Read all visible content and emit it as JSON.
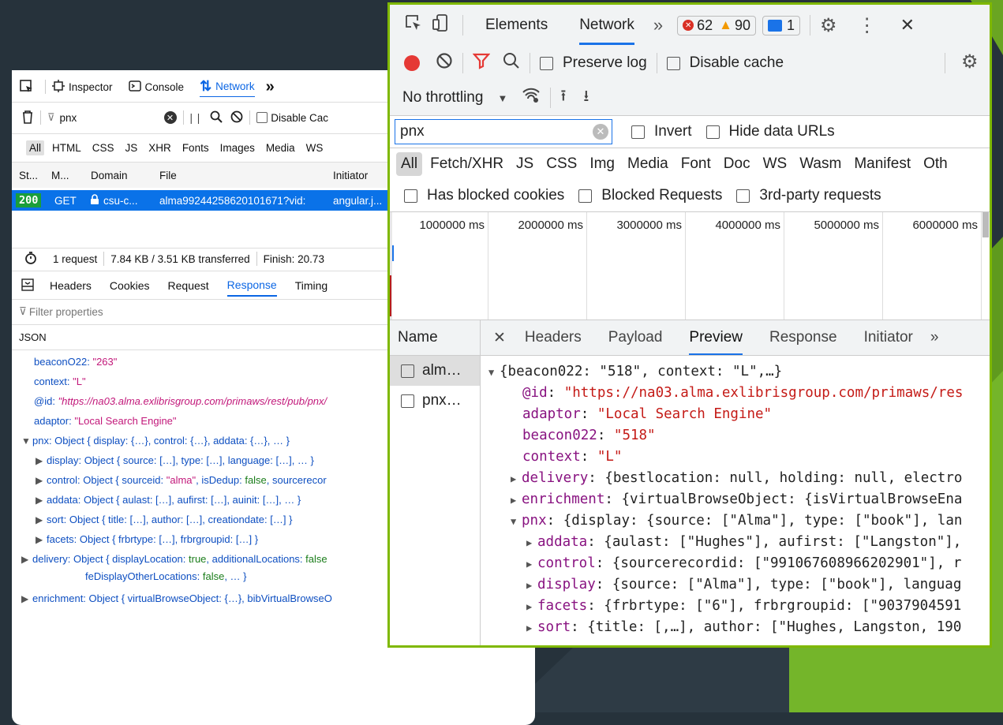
{
  "firefox": {
    "toolbar_tabs": [
      {
        "icon": "inspector-icon",
        "label": "Inspector"
      },
      {
        "icon": "console-icon",
        "label": "Console"
      },
      {
        "icon": "network-arrows-icon",
        "label": "Network"
      }
    ],
    "more_tools": "»",
    "filter_value": "pnx",
    "pause_glyph": "| |",
    "disable_cache_label": "Disable Cac",
    "type_filters": [
      "All",
      "HTML",
      "CSS",
      "JS",
      "XHR",
      "Fonts",
      "Images",
      "Media",
      "WS"
    ],
    "columns": [
      "St...",
      "M...",
      "Domain",
      "File",
      "Initiator"
    ],
    "request": {
      "status": "200",
      "method": "GET",
      "domain": "csu-c...",
      "file": "alma99244258620101671?vid:",
      "initiator": "angular.j..."
    },
    "summary": {
      "requests": "1 request",
      "transferred": "7.84 KB / 3.51 KB transferred",
      "finish": "Finish: 20.73"
    },
    "detail_tabs": [
      "Headers",
      "Cookies",
      "Request",
      "Response",
      "Timing"
    ],
    "filter_properties": "Filter properties",
    "json_label": "JSON",
    "json_lines": [
      {
        "key": "beaconO22: ",
        "value": "\"263\""
      },
      {
        "key": "context: ",
        "value": "\"L\""
      },
      {
        "key": "@id: ",
        "value": "\"https://na03.alma.exlibrisgroup.com/primaws/rest/pub/pnx/"
      },
      {
        "key": "adaptor: ",
        "value": "\"Local Search Engine\""
      },
      {
        "text": "pnx: Object { display: {…}, control: {…}, addata: {…}, … }"
      },
      {
        "text": "display: Object { source: […], type: […], language: […], … }"
      },
      {
        "pre": "control: Object { sourceid: ",
        "str": "\"alma\"",
        "mid": ", isDedup: ",
        "bool": "false",
        "post": ", sourcerecor"
      },
      {
        "text": "addata: Object { aulast: […], aufirst: […], auinit: […], … }"
      },
      {
        "text": "sort: Object { title: […], author: […], creationdate: […] }"
      },
      {
        "text": "facets: Object { frbrtype: […], frbrgroupid: […] }"
      },
      {
        "pre": "delivery: Object { displayLocation: ",
        "bool": "true",
        "mid": ", additionalLocations: ",
        "bool2": "false"
      },
      {
        "pre": "feDisplayOtherLocations: ",
        "bool": "false",
        "post": ", … }"
      },
      {
        "text": "enrichment: Object { virtualBrowseObject: {…}, bibVirtualBrowseO"
      }
    ]
  },
  "chrome": {
    "top_tabs": [
      "Elements",
      "Network"
    ],
    "more_tabs": "»",
    "errors": "62",
    "warnings": "90",
    "messages": "1",
    "close_glyph": "✕",
    "preserve_log": "Preserve log",
    "disable_cache": "Disable cache",
    "throttling": "No throttling",
    "filter_value": "pnx",
    "invert": "Invert",
    "hide_data_urls": "Hide data URLs",
    "type_filters": [
      "All",
      "Fetch/XHR",
      "JS",
      "CSS",
      "Img",
      "Media",
      "Font",
      "Doc",
      "WS",
      "Wasm",
      "Manifest",
      "Oth"
    ],
    "blocked_cookies": "Has blocked cookies",
    "blocked_requests": "Blocked Requests",
    "third_party": "3rd-party requests",
    "timeline_ticks": [
      "1000000 ms",
      "2000000 ms",
      "3000000 ms",
      "4000000 ms",
      "5000000 ms",
      "6000000 ms"
    ],
    "name_header": "Name",
    "name_items": [
      "alm…",
      "pnx…"
    ],
    "detail_tabs": [
      "Headers",
      "Payload",
      "Preview",
      "Response",
      "Initiator"
    ],
    "detail_more": "»",
    "preview_lines": [
      {
        "text": "{beacon022: \"518\", context: \"L\",…}"
      },
      {
        "key": "@id",
        "value": "\"https://na03.alma.exlibrisgroup.com/primaws/res"
      },
      {
        "key": "adaptor",
        "value": "\"Local Search Engine\""
      },
      {
        "key": "beacon022",
        "value": "\"518\""
      },
      {
        "key": "context",
        "value": "\"L\""
      },
      {
        "key": "delivery",
        "rest": "{bestlocation: null, holding: null, electro"
      },
      {
        "key": "enrichment",
        "rest": "{virtualBrowseObject: {isVirtualBrowseEna"
      },
      {
        "key": "pnx",
        "rest": "{display: {source: [\"Alma\"], type: [\"book\"], lan"
      },
      {
        "key": "addata",
        "rest": "{aulast: [\"Hughes\"], aufirst: [\"Langston\"],"
      },
      {
        "key": "control",
        "rest": "{sourcerecordid: [\"991067608966202901\"], r"
      },
      {
        "key": "display",
        "rest": "{source: [\"Alma\"], type: [\"book\"], languag"
      },
      {
        "key": "facets",
        "rest": "{frbrtype: [\"6\"], frbrgroupid: [\"9037904591"
      },
      {
        "key": "sort",
        "rest": "{title: [,…], author: [\"Hughes, Langston, 190"
      }
    ]
  }
}
